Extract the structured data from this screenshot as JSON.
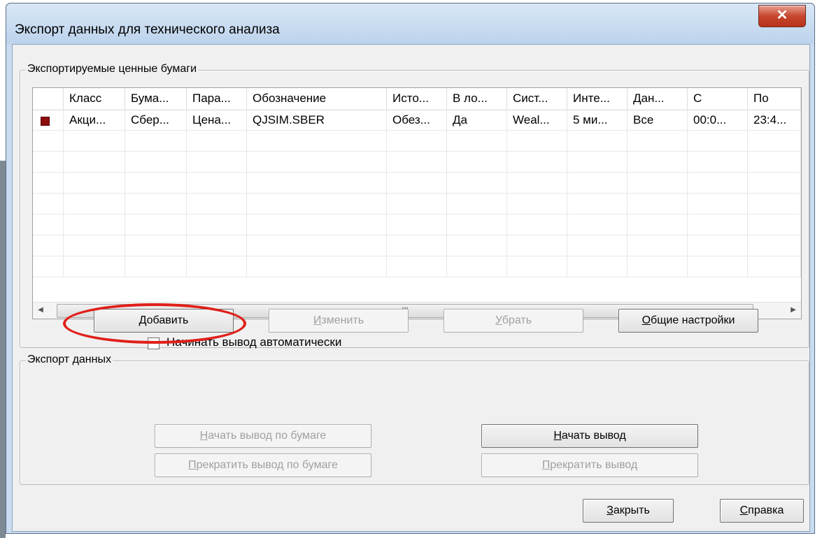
{
  "window": {
    "title": "Экспорт данных для технического анализа",
    "close_glyph": "✕"
  },
  "securities_group": {
    "label": "Экспортируемые ценные бумаги",
    "columns": [
      "",
      "Класс",
      "Бума...",
      "Пара...",
      "Обозначение",
      "Исто...",
      "В ло...",
      "Сист...",
      "Инте...",
      "Дан...",
      "С",
      "По"
    ],
    "rows": [
      {
        "color": "#8b0d0d",
        "cells": [
          "Акци...",
          "Сбер...",
          "Цена...",
          "QJSIM.SBER",
          "Обез...",
          "Да",
          "Weal...",
          "5 ми...",
          "Все",
          "00:0...",
          "23:4..."
        ]
      }
    ],
    "scroll_thumb_glyph": "III",
    "buttons": {
      "add": {
        "pre": "",
        "ul": "Д",
        "post": "обавить"
      },
      "edit": {
        "pre": "",
        "ul": "И",
        "post": "зменить"
      },
      "remove": {
        "pre": "",
        "ul": "У",
        "post": "брать"
      },
      "general": {
        "pre": "",
        "ul": "О",
        "post": "бщие настройки"
      }
    }
  },
  "export_group": {
    "label": "Экспорт данных",
    "auto_start_label": "Начинать вывод автоматически",
    "auto_start_checked": false,
    "buttons": {
      "start_security": {
        "pre": "",
        "ul": "Н",
        "post": "ачать вывод по бумаге"
      },
      "stop_security": {
        "pre": "",
        "ul": "П",
        "post": "рекратить вывод по бумаге"
      },
      "start": {
        "pre": "",
        "ul": "Н",
        "post": "ачать вывод"
      },
      "stop": {
        "pre": "",
        "ul": "П",
        "post": "рекратить вывод"
      }
    }
  },
  "footer": {
    "close": {
      "pre": "",
      "ul": "З",
      "post": "акрыть"
    },
    "help": {
      "pre": "",
      "ul": "С",
      "post": "правка"
    }
  },
  "colors": {
    "annotation": "#e0201a",
    "row_marker": "#8b0d0d"
  }
}
